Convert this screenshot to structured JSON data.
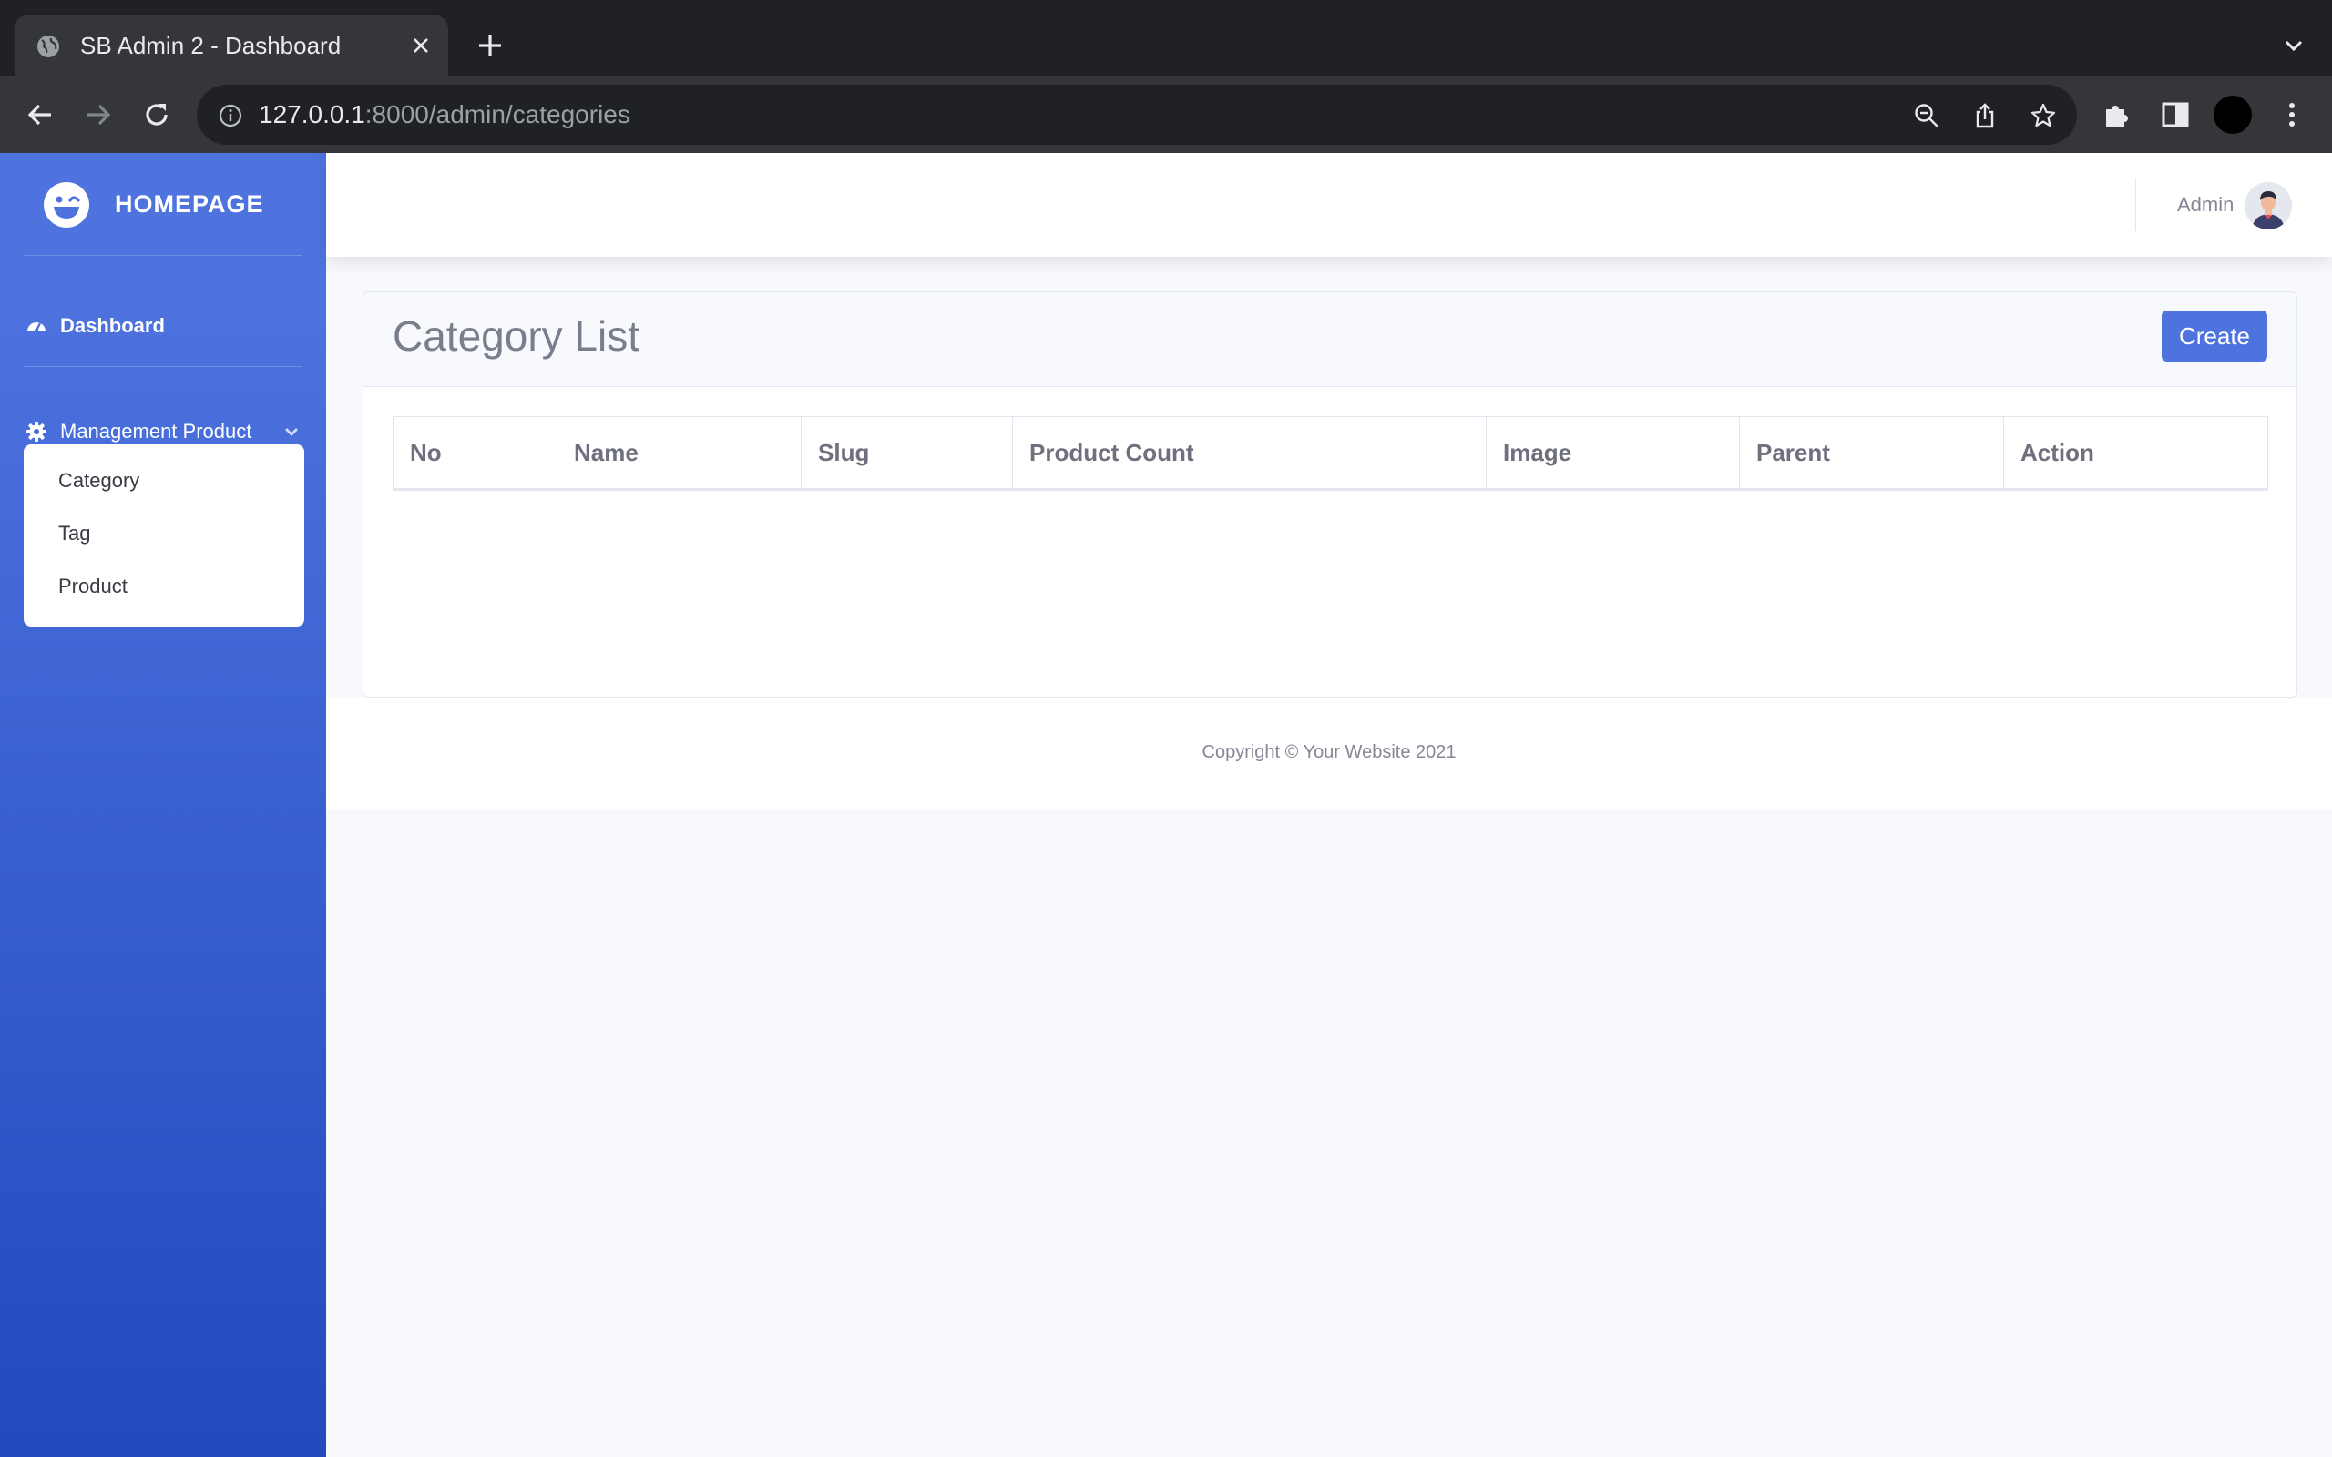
{
  "browser": {
    "tab_title": "SB Admin 2 - Dashboard",
    "url_host": "127.0.0.1",
    "url_rest": ":8000/admin/categories",
    "icons": [
      "globe-icon",
      "close-icon",
      "new-tab-icon",
      "tab-list-icon",
      "back-icon",
      "forward-icon",
      "reload-icon",
      "info-icon",
      "zoom-icon",
      "share-icon",
      "bookmark-star-icon",
      "extensions-icon",
      "side-panel-icon",
      "profile-avatar",
      "menu-icon"
    ]
  },
  "sidebar": {
    "brand": "HOMEPAGE",
    "items": [
      {
        "label": "Dashboard",
        "icon": "tachometer-icon"
      },
      {
        "label": "Management Product",
        "icon": "gear-icon",
        "expanded": true
      }
    ],
    "submenu": [
      "Category",
      "Tag",
      "Product"
    ]
  },
  "topbar": {
    "user_name": "Admin"
  },
  "main": {
    "title": "Category List",
    "create_label": "Create",
    "columns": [
      "No",
      "Name",
      "Slug",
      "Product Count",
      "Image",
      "Parent",
      "Action"
    ],
    "rows": []
  },
  "footer": {
    "copyright": "Copyright © Your Website 2021"
  },
  "colors": {
    "primary": "#4e73df",
    "sidebar_gradient_end": "#224abe",
    "page_background": "#f8f9fc"
  }
}
